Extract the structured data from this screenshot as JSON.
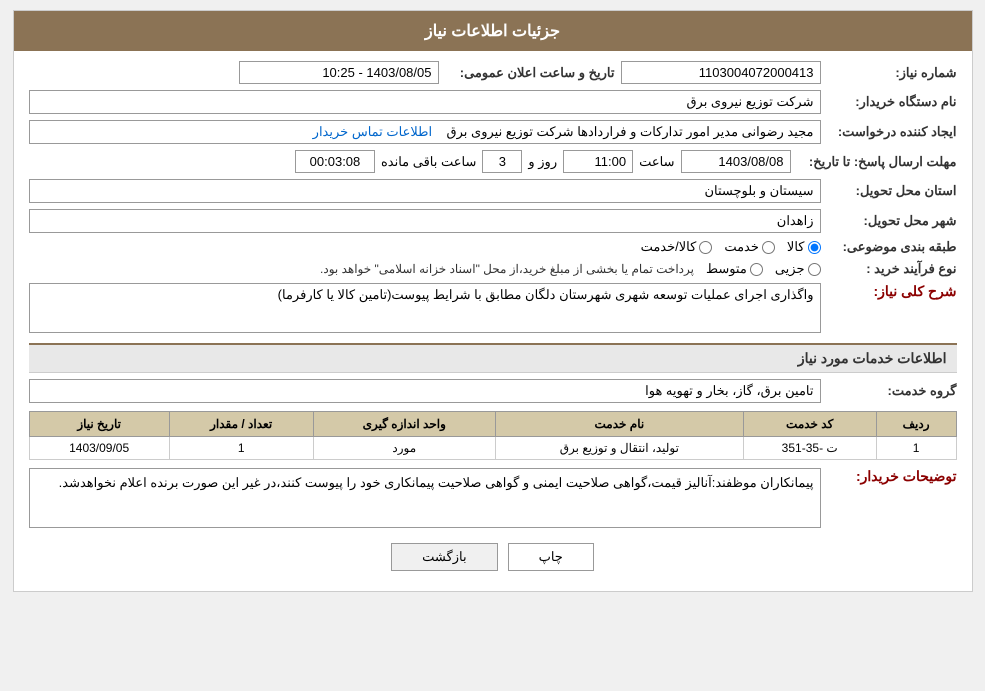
{
  "header": {
    "title": "جزئیات اطلاعات نیاز"
  },
  "fields": {
    "need_number_label": "شماره نیاز:",
    "need_number_value": "1103004072000413",
    "buyer_org_label": "نام دستگاه خریدار:",
    "buyer_org_value": "شرکت توزیع نیروی برق",
    "creator_label": "ایجاد کننده درخواست:",
    "creator_value": "مجید  رضوانی مدیر امور تداركات و فراردادها شركت توزیع نیروی برق",
    "creator_link": "اطلاعات تماس خریدار",
    "response_deadline_label": "مهلت ارسال پاسخ: تا تاریخ:",
    "response_date": "1403/08/08",
    "response_time_label": "ساعت",
    "response_time": "11:00",
    "response_days_label": "روز و",
    "response_days": "3",
    "remaining_label": "ساعت باقی مانده",
    "remaining_time": "00:03:08",
    "announce_label": "تاریخ و ساعت اعلان عمومی:",
    "announce_value": "1403/08/05 - 10:25",
    "province_label": "استان محل تحویل:",
    "province_value": "سیستان و بلوچستان",
    "city_label": "شهر محل تحویل:",
    "city_value": "زاهدان",
    "category_label": "طبقه بندی موضوعی:",
    "category_goods": "کالا",
    "category_service": "خدمت",
    "category_goods_service": "کالا/خدمت",
    "process_label": "نوع فرآیند خرید :",
    "process_partial": "جزیی",
    "process_medium": "متوسط",
    "process_notice": "پرداخت تمام یا بخشی از مبلغ خرید،از محل \"اسناد خزانه اسلامی\" خواهد بود.",
    "description_section": "شرح کلی نیاز:",
    "description_value": "واگذاری اجرای عملیات توسعه شهری شهرستان دلگان مطابق با شرایط پیوست(تامین کالا یا کارفرما)",
    "services_section": "اطلاعات خدمات مورد نیاز",
    "service_group_label": "گروه خدمت:",
    "service_group_value": "تامین برق، گاز، بخار و تهویه هوا",
    "table": {
      "columns": [
        "ردیف",
        "کد خدمت",
        "نام خدمت",
        "واحد اندازه گیری",
        "تعداد / مقدار",
        "تاریخ نیاز"
      ],
      "rows": [
        {
          "index": "1",
          "code": "ت -35-351",
          "name": "تولید، انتقال و توزیع برق",
          "unit": "مورد",
          "quantity": "1",
          "date": "1403/09/05"
        }
      ]
    },
    "buyer_notes_label": "توضیحات خریدار:",
    "buyer_notes_value": "پیمانکاران موظفند:آنالیز قیمت،گواهی صلاحیت ایمنی و گواهی صلاحیت پیمانکاری خود را پیوست کنند،در غیر این صورت برنده اعلام نخواهدشد."
  },
  "buttons": {
    "print_label": "چاپ",
    "back_label": "بازگشت"
  }
}
